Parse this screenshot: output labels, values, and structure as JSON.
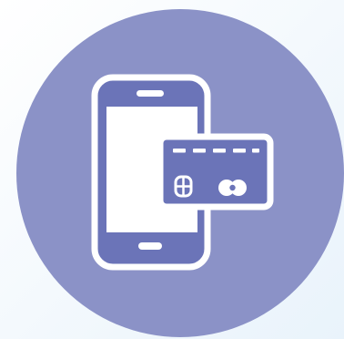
{
  "icon": {
    "name": "mobile-payment",
    "colors": {
      "page_background": "#ffffff",
      "corner_tint": "#e6f2fb",
      "circle_fill": "#8b92c7",
      "device_fill": "#6b74b8",
      "screen_fill": "#ffffff",
      "outline": "#ffffff"
    },
    "parts": [
      "background-circle",
      "smartphone-icon",
      "credit-card-icon",
      "card-chip-icon",
      "card-network-logo-icon"
    ]
  }
}
